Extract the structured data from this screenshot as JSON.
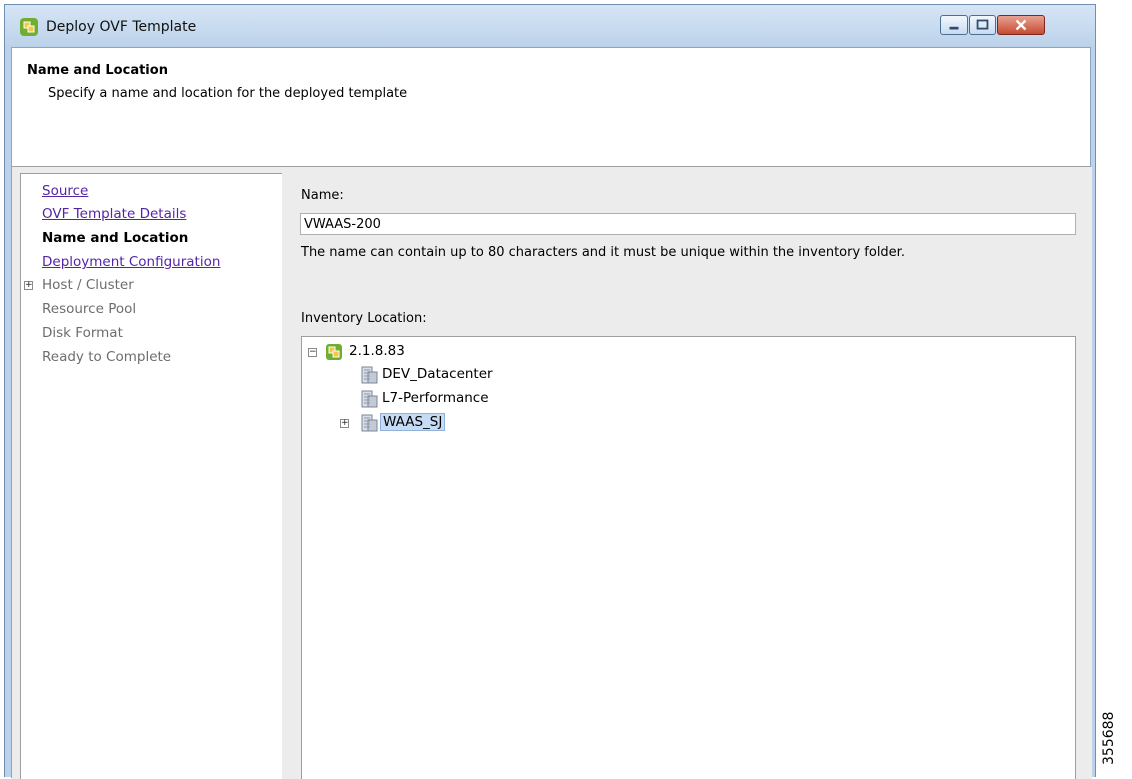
{
  "window": {
    "title": "Deploy OVF Template"
  },
  "header": {
    "title": "Name and Location",
    "subtitle": "Specify a name and location for the deployed template"
  },
  "steps": [
    {
      "label": "Source",
      "state": "link"
    },
    {
      "label": "OVF Template Details",
      "state": "link"
    },
    {
      "label": "Name and Location",
      "state": "current"
    },
    {
      "label": "Deployment Configuration",
      "state": "link"
    },
    {
      "label": "Host / Cluster",
      "state": "disabled",
      "expandable": true
    },
    {
      "label": "Resource Pool",
      "state": "disabled"
    },
    {
      "label": "Disk Format",
      "state": "disabled"
    },
    {
      "label": "Ready to Complete",
      "state": "disabled"
    }
  ],
  "form": {
    "name_label": "Name:",
    "name_value": "VWAAS-200",
    "name_hint": "The name can contain up to 80 characters and it must be unique within the inventory folder.",
    "inventory_label": "Inventory Location:"
  },
  "inventory_tree": {
    "root": {
      "label": "2.1.8.83",
      "expanded": true,
      "icon": "vcenter-icon"
    },
    "children": [
      {
        "label": "DEV_Datacenter",
        "icon": "datacenter-icon"
      },
      {
        "label": "L7-Performance",
        "icon": "datacenter-icon"
      },
      {
        "label": "WAAS_SJ",
        "icon": "datacenter-icon",
        "selected": true,
        "expandable": true
      }
    ]
  },
  "figure_id": "355688",
  "colors": {
    "link": "#5424a8",
    "selection": "#c6dbf4",
    "close_button": "#c74a31"
  }
}
